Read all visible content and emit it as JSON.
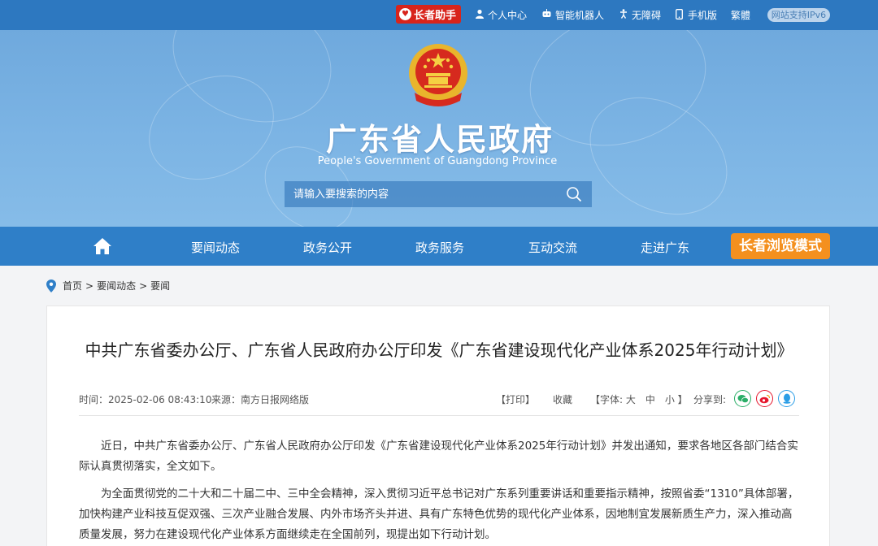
{
  "topbar": {
    "elder_helper": "长者助手",
    "personal_center": "个人中心",
    "robot": "智能机器人",
    "accessibility": "无障碍",
    "mobile": "手机版",
    "traditional": "繁體",
    "ipv6": "网站支持IPv6"
  },
  "banner": {
    "title": "广东省人民政府",
    "subtitle": "People's Government of Guangdong Province",
    "search_placeholder": "请输入要搜索的内容"
  },
  "nav": {
    "items": [
      "要闻动态",
      "政务公开",
      "政务服务",
      "互动交流",
      "走进广东"
    ],
    "elder_mode": "长者浏览模式"
  },
  "breadcrumb": {
    "home": "首页",
    "sep": ">",
    "level1": "要闻动态",
    "level2": "要闻"
  },
  "article": {
    "title": "中共广东省委办公厅、广东省人民政府办公厅印发《广东省建设现代化产业体系2025年行动计划》",
    "time": "时间：2025-02-06 08:43:10",
    "source": "来源：南方日报网络版",
    "print": "【打印】",
    "favorite": "收藏",
    "font_size_label": "【字体: 大　中　小 】",
    "share_label": "分享到:",
    "paragraphs": [
      "近日，中共广东省委办公厅、广东省人民政府办公厅印发《广东省建设现代化产业体系2025年行动计划》并发出通知，要求各地区各部门结合实际认真贯彻落实，全文如下。",
      "为全面贯彻党的二十大和二十届二中、三中全会精神，深入贯彻习近平总书记对广东系列重要讲话和重要指示精神，按照省委“1310”具体部署，加快构建产业科技互促双强、三次产业融合发展、内外市场齐头并进、具有广东特色优势的现代化产业体系，因地制宜发展新质生产力，深入推动高质量发展，努力在建设现代化产业体系方面继续走在全国前列，现提出如下行动计划。"
    ]
  },
  "colors": {
    "topbar": "#2d78c0",
    "nav": "#2f7fc8",
    "elder_red": "#d8241c",
    "elder_orange": "#f4901e",
    "wechat": "#2aae67",
    "weibo": "#e6162d",
    "qq": "#2a9de6"
  }
}
